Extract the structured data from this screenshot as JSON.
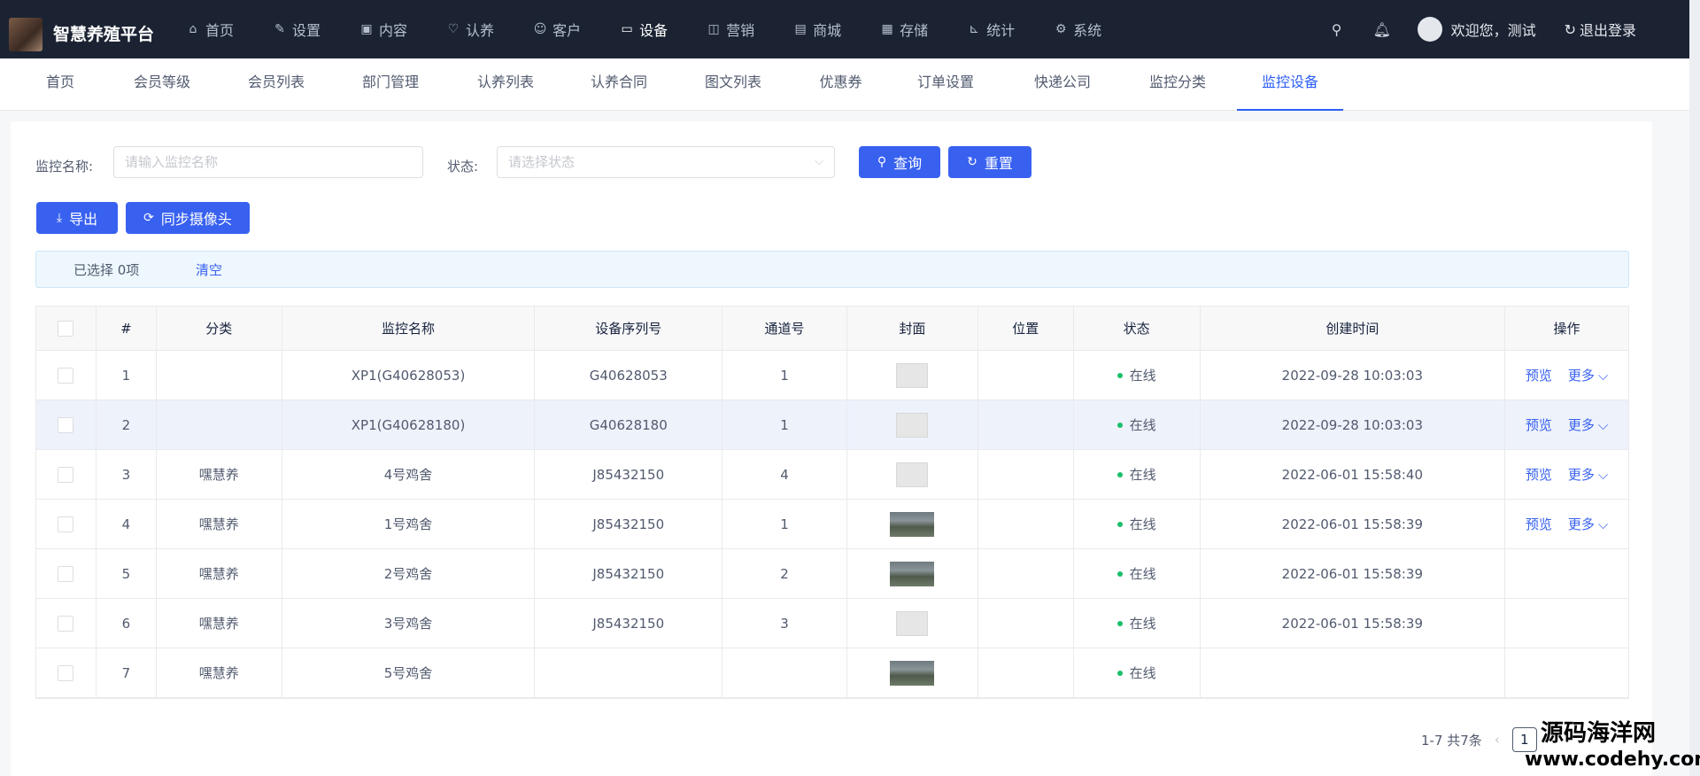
{
  "app": {
    "title": "智慧养殖平台"
  },
  "nav": [
    {
      "label": "首页",
      "icon": "home-icon",
      "glyph": "⌂"
    },
    {
      "label": "设置",
      "icon": "pen-icon",
      "glyph": "✎"
    },
    {
      "label": "内容",
      "icon": "image-icon",
      "glyph": "▣"
    },
    {
      "label": "认养",
      "icon": "heart-icon",
      "glyph": "♡"
    },
    {
      "label": "客户",
      "icon": "user-icon",
      "glyph": "☺"
    },
    {
      "label": "设备",
      "icon": "camera-icon",
      "glyph": "▭"
    },
    {
      "label": "营销",
      "icon": "gift-icon",
      "glyph": "◫"
    },
    {
      "label": "商城",
      "icon": "store-icon",
      "glyph": "▤"
    },
    {
      "label": "存储",
      "icon": "storage-icon",
      "glyph": "▦"
    },
    {
      "label": "统计",
      "icon": "chart-icon",
      "glyph": "⊾"
    },
    {
      "label": "系统",
      "icon": "gear-icon",
      "glyph": "⚙"
    }
  ],
  "user": {
    "welcome": "欢迎您，测试",
    "logout": "退出登录"
  },
  "subtabs": [
    "首页",
    "会员等级",
    "会员列表",
    "部门管理",
    "认养列表",
    "认养合同",
    "图文列表",
    "优惠券",
    "订单设置",
    "快递公司",
    "监控分类",
    "监控设备"
  ],
  "filters": {
    "name_label": "监控名称:",
    "name_placeholder": "请输入监控名称",
    "status_label": "状态:",
    "status_placeholder": "请选择状态",
    "query": "查询",
    "reset": "重置"
  },
  "actions": {
    "export": "导出",
    "sync": "同步摄像头"
  },
  "selection": {
    "text": "已选择 0项",
    "clear": "清空"
  },
  "table": {
    "headers": [
      "",
      "#",
      "分类",
      "监控名称",
      "设备序列号",
      "通道号",
      "封面",
      "位置",
      "状态",
      "创建时间",
      "操作"
    ],
    "rows": [
      {
        "idx": "1",
        "category": "",
        "name": "XP1(G40628053)",
        "serial": "G40628053",
        "channel": "1",
        "cover": "placeholder",
        "location": "",
        "status": "在线",
        "created": "2022-09-28 10:03:03",
        "preview": "预览",
        "more": "更多"
      },
      {
        "idx": "2",
        "category": "",
        "name": "XP1(G40628180)",
        "serial": "G40628180",
        "channel": "1",
        "cover": "placeholder",
        "location": "",
        "status": "在线",
        "created": "2022-09-28 10:03:03",
        "preview": "预览",
        "more": "更多"
      },
      {
        "idx": "3",
        "category": "嘿慧养",
        "name": "4号鸡舍",
        "serial": "J85432150",
        "channel": "4",
        "cover": "placeholder",
        "location": "",
        "status": "在线",
        "created": "2022-06-01 15:58:40",
        "preview": "预览",
        "more": "更多"
      },
      {
        "idx": "4",
        "category": "嘿慧养",
        "name": "1号鸡舍",
        "serial": "J85432150",
        "channel": "1",
        "cover": "photo",
        "location": "",
        "status": "在线",
        "created": "2022-06-01 15:58:39",
        "preview": "预览",
        "more": "更多"
      },
      {
        "idx": "5",
        "category": "嘿慧养",
        "name": "2号鸡舍",
        "serial": "J85432150",
        "channel": "2",
        "cover": "photo",
        "location": "",
        "status": "在线",
        "created": "2022-06-01 15:58:39",
        "preview": "",
        "more": ""
      },
      {
        "idx": "6",
        "category": "嘿慧养",
        "name": "3号鸡舍",
        "serial": "J85432150",
        "channel": "3",
        "cover": "placeholder",
        "location": "",
        "status": "在线",
        "created": "2022-06-01 15:58:39",
        "preview": "",
        "more": ""
      },
      {
        "idx": "7",
        "category": "嘿慧养",
        "name": "5号鸡舍",
        "serial": "",
        "channel": "",
        "cover": "photo",
        "location": "",
        "status": "在线",
        "created": "",
        "preview": "",
        "more": ""
      }
    ]
  },
  "pagination": {
    "summary": "1-7 共7条",
    "current": "1"
  },
  "watermark": {
    "line1": "源码海洋网",
    "line2": "www.codehy.com"
  },
  "colors": {
    "topbar": "#1b2333",
    "accent": "#3861f0",
    "online": "#19be6b"
  }
}
